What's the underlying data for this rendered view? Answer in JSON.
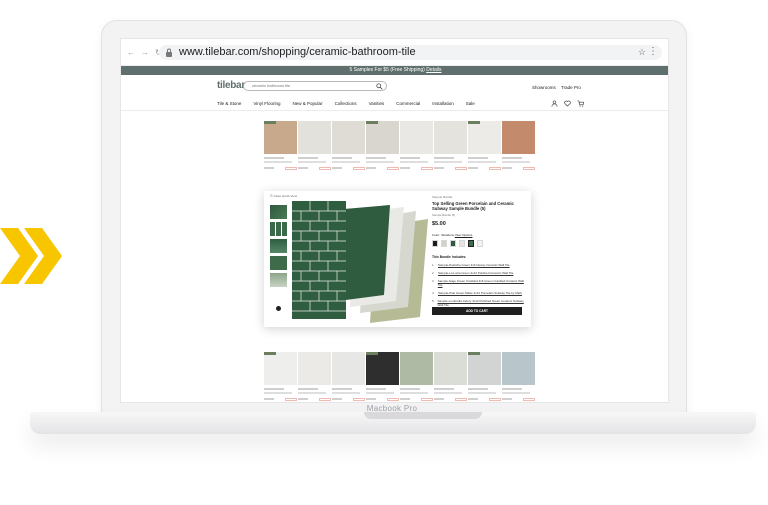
{
  "browser": {
    "url": "www.tilebar.com/shopping/ceramic-bathroom-tile",
    "nav_icons": [
      "back-icon",
      "forward-icon",
      "reload-icon"
    ]
  },
  "promo": {
    "text": "5 Samples For $5 (Free Shipping)",
    "link": "Details"
  },
  "header": {
    "logo": "tilebar",
    "search_value": "ceramic bathroom tile",
    "links": [
      "Showrooms",
      "Trade Pro"
    ]
  },
  "nav": {
    "items": [
      "Tile & Stone",
      "Vinyl Flooring",
      "New & Popular",
      "Collections",
      "Vanities",
      "Commercial",
      "Installation",
      "Sale"
    ]
  },
  "product_rows": {
    "top_colors": [
      "#c8a98b",
      "#e3e1dc",
      "#dfdcd6",
      "#d9d6cf",
      "#e9e8e4",
      "#e5e3de",
      "#ecebe8",
      "#c38a6b"
    ],
    "bottom_colors": [
      "#eeeeec",
      "#ebeae7",
      "#e7e7e5",
      "#2e2e2e",
      "#aebaa4",
      "#d9ddd5",
      "#d2d4d4",
      "#b8c6cc"
    ]
  },
  "modal": {
    "close_label": "Close Quick View",
    "brand": "Sample Bundle",
    "title": "Top Selling Green Porcelain and Ceramic Subway Sample Bundle (5)",
    "rating": "Sample Bundle (5)",
    "price": "$5.00",
    "color_label": "Color: Variations",
    "color_link": "View Options",
    "swatch_colors": [
      "#1c1c1c",
      "#cfd3c8",
      "#2f5a3e",
      "#e6e6e2",
      "#3f6b4a",
      "#f3f3f1"
    ],
    "bundle_label": "This Bundle Includes:",
    "bundle_items": [
      "Sample-Pastiche Green 3x6 Glossy Ceramic Wall Tile",
      "Sample-La Lucia Green 4x12 Polished Ceramic Wall Tile",
      "Sample-Sage Green Crackled 3x6 Green Crackled Ceramic Wall Tile",
      "Sample-Pale Green Matte 3x12 Porcelain Subway Tile by Mark",
      "Sample-Lumbrella Celery 3x12 Polished Green Ceramic Subway Wall Tile"
    ],
    "add_label": "ADD TO CART"
  },
  "device": {
    "label": "Macbook Pro"
  },
  "colors": {
    "accent": "#5f6f6d",
    "chevron": "#f7c600",
    "tile_green_dark": "#2f5a3e"
  }
}
